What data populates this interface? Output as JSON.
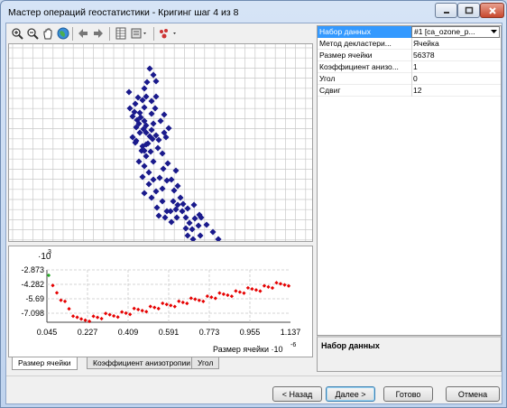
{
  "window": {
    "title": "Мастер операций геостатистики - Кригинг шаг 4 из 8"
  },
  "toolbar": {
    "icons": [
      "zoom-in-icon",
      "zoom-out-icon",
      "pan-hand-icon",
      "globe-icon",
      "back-arrow-icon",
      "forward-arrow-icon",
      "table-icon",
      "layers-dropdown-icon",
      "points-dropdown-icon"
    ]
  },
  "semivariogram": {
    "exponent_label": "·10",
    "exponent_power": "3",
    "y_ticks": [
      "-2.873",
      "-4.282",
      "-5.69",
      "-7.098"
    ],
    "x_ticks": [
      "0.045",
      "0.227",
      "0.409",
      "0.591",
      "0.773",
      "0.955",
      "1.137"
    ],
    "x_axis_label": "Размер ячейки ·10",
    "x_axis_power": "-6",
    "colors": {
      "points": "#e60000",
      "first_point": "#22aa22",
      "scatter": "#1a1a8c"
    }
  },
  "tabs": [
    {
      "label": "Размер ячейки",
      "active": true
    },
    {
      "label": "Коэффициент анизотропии",
      "active": false
    },
    {
      "label": "Угол",
      "active": false
    }
  ],
  "properties": [
    {
      "name": "Набор данных",
      "value": "#1 [ca_ozone_p...",
      "selected": true,
      "dropdown": true
    },
    {
      "name": "Метод декластери...",
      "value": "Ячейка"
    },
    {
      "name": "Размер ячейки",
      "value": "56378"
    },
    {
      "name": "Коэффициент анизо...",
      "value": "1"
    },
    {
      "name": "Угол",
      "value": "0"
    },
    {
      "name": "Сдвиг",
      "value": "12"
    }
  ],
  "description": {
    "title": "Набор данных"
  },
  "buttons": {
    "back": "< Назад",
    "next": "Далее >",
    "finish": "Готово",
    "cancel": "Отмена"
  }
}
